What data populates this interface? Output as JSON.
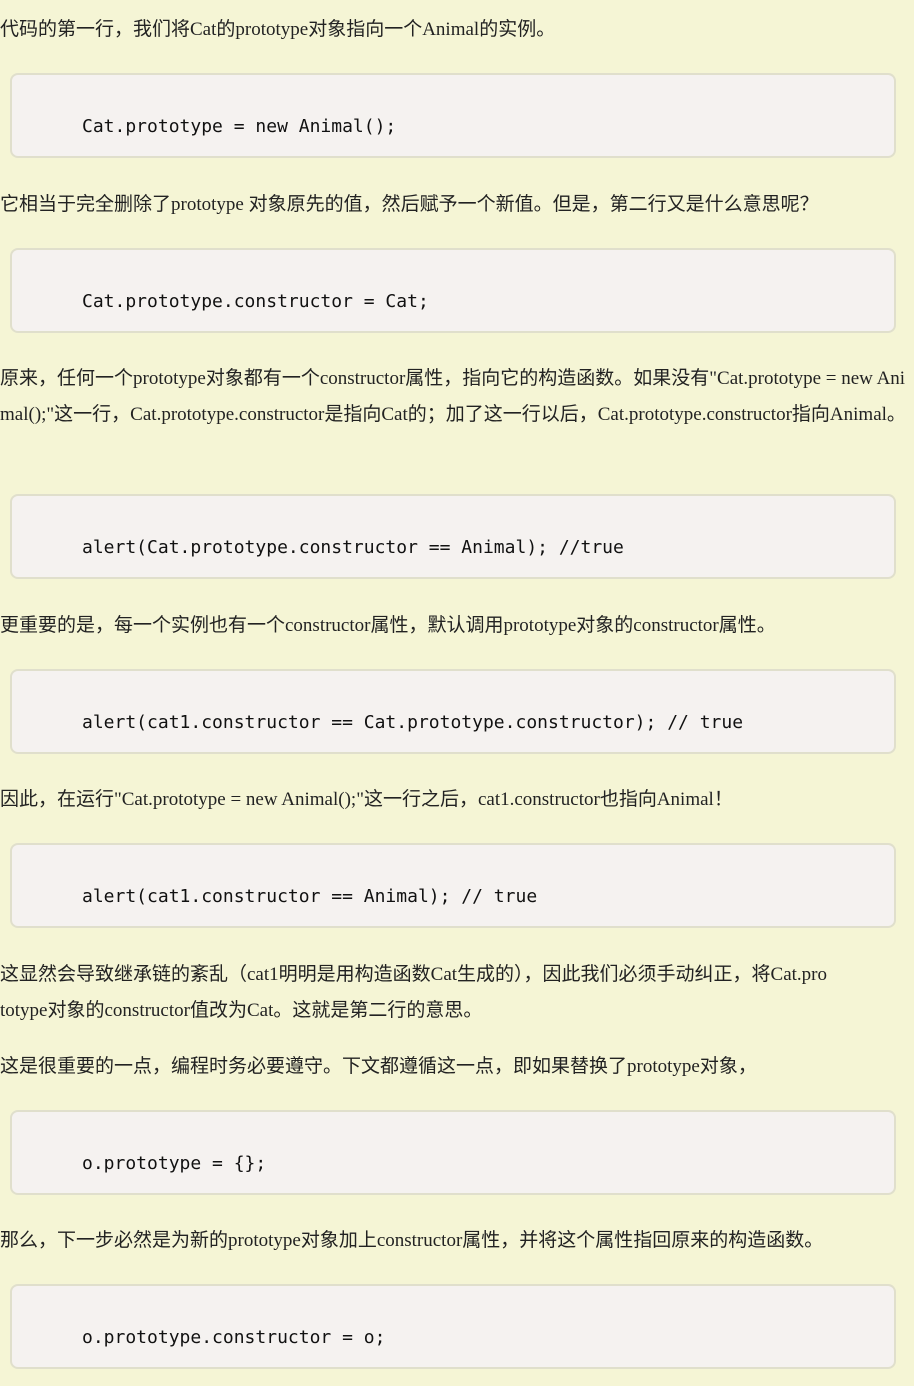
{
  "article": {
    "p1": "代码的第一行，我们将Cat的prototype对象指向一个Animal的实例。",
    "code1": "Cat.prototype = new Animal();",
    "p2": "它相当于完全删除了prototype 对象原先的值，然后赋予一个新值。但是，第二行又是什么意思呢？",
    "code2": "Cat.prototype.constructor = Cat;",
    "p3": "原来，任何一个prototype对象都有一个constructor属性，指向它的构造函数。如果没有\"Cat.prototype = new Animal();\"这一行，Cat.prototype.constructor是指向Cat的；加了这一行以后，Cat.prototype.constructor指向Animal。",
    "code3": "alert(Cat.prototype.constructor == Animal); //true",
    "p4": "更重要的是，每一个实例也有一个constructor属性，默认调用prototype对象的constructor属性。",
    "code4": "alert(cat1.constructor == Cat.prototype.constructor); // true",
    "p5": "因此，在运行\"Cat.prototype = new Animal();\"这一行之后，cat1.constructor也指向Animal！",
    "code5": "alert(cat1.constructor == Animal); // true",
    "p6": "这显然会导致继承链的紊乱（cat1明明是用构造函数Cat生成的），因此我们必须手动纠正，将Cat.prototype对象的constructor值改为Cat。这就是第二行的意思。",
    "p7": "这是很重要的一点，编程时务必要遵守。下文都遵循这一点，即如果替换了prototype对象，",
    "code6": "o.prototype = {};",
    "p8": "那么，下一步必然是为新的prototype对象加上constructor属性，并将这个属性指回原来的构造函数。",
    "code7": "o.prototype.constructor = o;"
  }
}
